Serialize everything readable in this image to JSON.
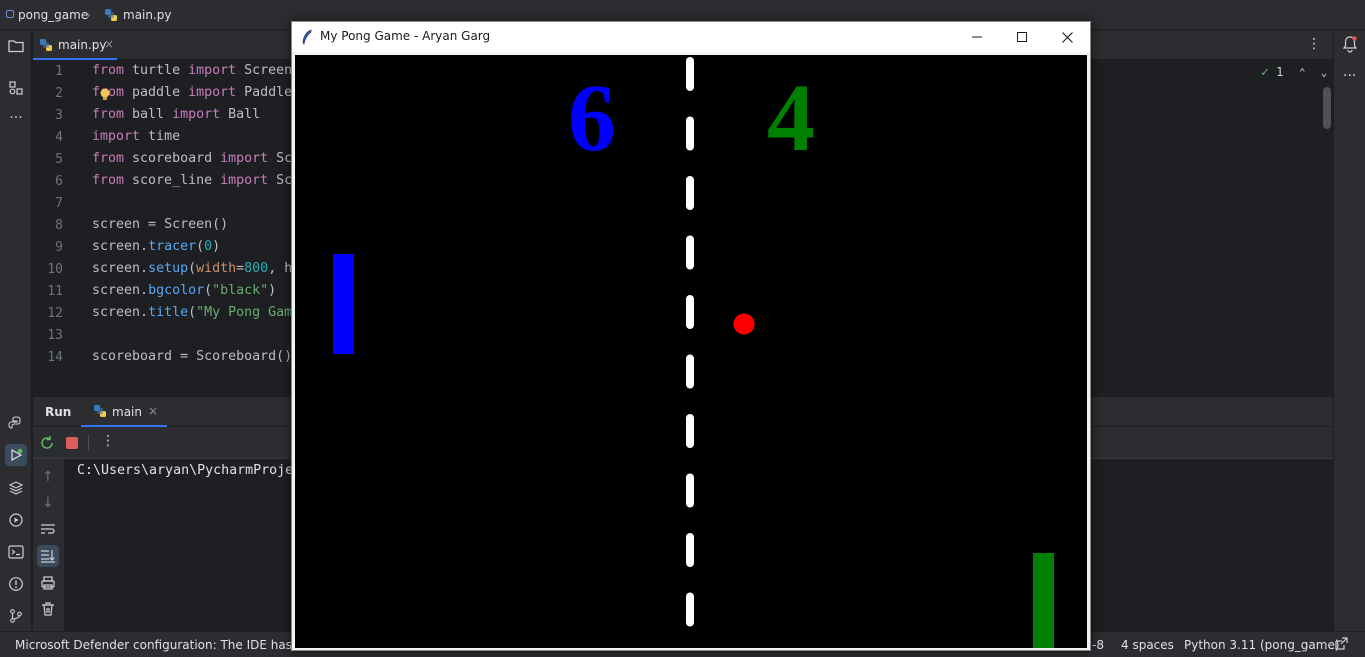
{
  "breadcrumb": {
    "project": "pong_game",
    "file": "main.py"
  },
  "editor": {
    "tab_label": "main.py",
    "inspection_count": "1",
    "lines": [
      {
        "n": "1"
      },
      {
        "n": "2"
      },
      {
        "n": "3"
      },
      {
        "n": "4"
      },
      {
        "n": "5"
      },
      {
        "n": "6"
      },
      {
        "n": "7"
      },
      {
        "n": "8"
      },
      {
        "n": "9"
      },
      {
        "n": "10"
      },
      {
        "n": "11"
      },
      {
        "n": "12"
      },
      {
        "n": "13"
      },
      {
        "n": "14"
      }
    ],
    "code": {
      "l1": [
        "from",
        " turtle ",
        "import",
        " Screen"
      ],
      "l2": [
        "from",
        " paddle ",
        "import",
        " Paddle"
      ],
      "l3": [
        "from",
        " ball ",
        "import",
        " Ball"
      ],
      "l4": [
        "import",
        " time"
      ],
      "l5": [
        "from",
        " scoreboard ",
        "import",
        " Sc"
      ],
      "l6": [
        "from",
        " score_line ",
        "import",
        " Sc"
      ],
      "l8": [
        "screen",
        " = ",
        "Screen",
        "()"
      ],
      "l9": [
        "screen",
        ".",
        "tracer",
        "(",
        "0",
        ")"
      ],
      "l10": [
        "screen",
        ".",
        "setup",
        "(",
        "width",
        "=",
        "800",
        ", h"
      ],
      "l11": [
        "screen",
        ".",
        "bgcolor",
        "(",
        "\"black\"",
        ")"
      ],
      "l12": [
        "screen",
        ".",
        "title",
        "(",
        "\"My Pong Gam"
      ],
      "l14": [
        "scoreboard",
        " = ",
        "Scoreboard",
        "()"
      ]
    }
  },
  "run": {
    "tab_run": "Run",
    "tab_main": "main",
    "output": "C:\\Users\\aryan\\PycharmProje"
  },
  "status": {
    "message": "Microsoft Defender configuration: The IDE has detec",
    "encoding": "-8",
    "indent": "4 spaces",
    "interpreter": "Python 3.11 (pong_game)"
  },
  "game": {
    "title": "My Pong Game - Aryan Garg",
    "score_left": "6",
    "score_right": "4",
    "colors": {
      "left_paddle": "#0000ff",
      "right_paddle": "#008000",
      "ball": "#ff0000",
      "background": "#000000",
      "net": "#ffffff",
      "left_score": "#0000ff",
      "right_score": "#008000"
    }
  },
  "icons": {
    "folder": "folder-icon",
    "structure": "structure-icon",
    "more": "more-icon",
    "python": "python-console-icon",
    "run": "run-icon",
    "layers": "layers-icon",
    "services": "services-icon",
    "terminal": "terminal-icon",
    "problems": "problems-icon",
    "git": "git-icon",
    "notifications": "bell-icon"
  }
}
